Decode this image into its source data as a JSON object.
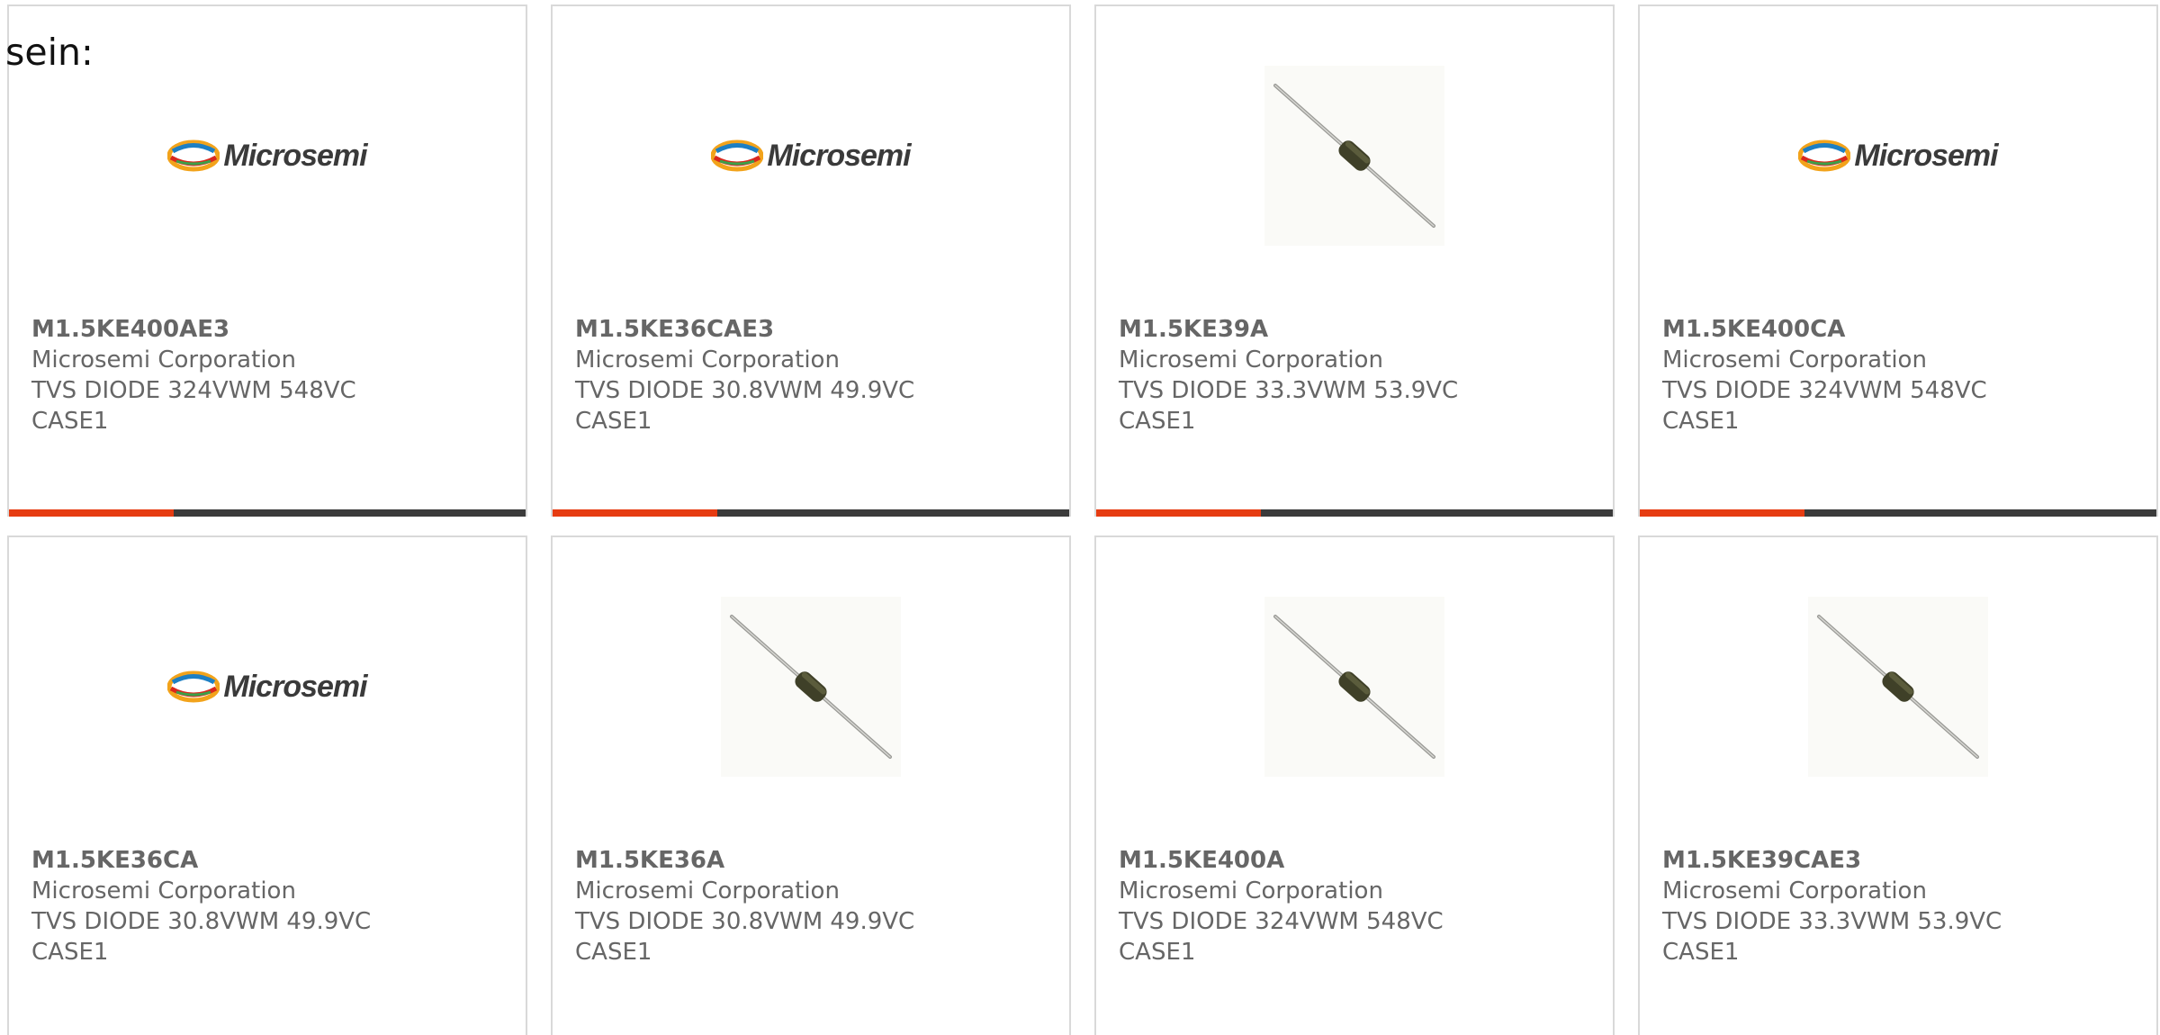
{
  "intro_text": "sein:",
  "colors": {
    "accent": "#e63c12",
    "bar": "#3b3b3b",
    "border": "#d9d9d9",
    "text": "#666666"
  },
  "products": [
    {
      "part": "M1.5KE400AE3",
      "manufacturer": "Microsemi Corporation",
      "description": "TVS DIODE 324VWM 548VC",
      "package": "CASE1",
      "image": "microsemi-logo"
    },
    {
      "part": "M1.5KE36CAE3",
      "manufacturer": "Microsemi Corporation",
      "description": "TVS DIODE 30.8VWM 49.9VC",
      "package": "CASE1",
      "image": "microsemi-logo"
    },
    {
      "part": "M1.5KE39A",
      "manufacturer": "Microsemi Corporation",
      "description": "TVS DIODE 33.3VWM 53.9VC",
      "package": "CASE1",
      "image": "diode-photo"
    },
    {
      "part": "M1.5KE400CA",
      "manufacturer": "Microsemi Corporation",
      "description": "TVS DIODE 324VWM 548VC",
      "package": "CASE1",
      "image": "microsemi-logo"
    },
    {
      "part": "M1.5KE36CA",
      "manufacturer": "Microsemi Corporation",
      "description": "TVS DIODE 30.8VWM 49.9VC",
      "package": "CASE1",
      "image": "microsemi-logo"
    },
    {
      "part": "M1.5KE36A",
      "manufacturer": "Microsemi Corporation",
      "description": "TVS DIODE 30.8VWM 49.9VC",
      "package": "CASE1",
      "image": "diode-photo"
    },
    {
      "part": "M1.5KE400A",
      "manufacturer": "Microsemi Corporation",
      "description": "TVS DIODE 324VWM 548VC",
      "package": "CASE1",
      "image": "diode-photo"
    },
    {
      "part": "M1.5KE39CAE3",
      "manufacturer": "Microsemi Corporation",
      "description": "TVS DIODE 33.3VWM 53.9VC",
      "package": "CASE1",
      "image": "diode-photo"
    }
  ],
  "logo_text": "Microsemi"
}
